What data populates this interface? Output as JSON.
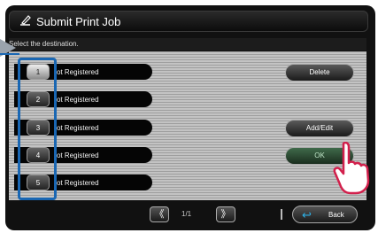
{
  "title_bar": {
    "title": "Submit Print Job",
    "icon": "edit-pen-icon"
  },
  "instruction": "Select the destination.",
  "destinations": [
    {
      "number": "1",
      "label": "ot Registered",
      "selected": true
    },
    {
      "number": "2",
      "label": "ot Registered",
      "selected": false
    },
    {
      "number": "3",
      "label": "ot Registered",
      "selected": false
    },
    {
      "number": "4",
      "label": "ot Registered",
      "selected": false
    },
    {
      "number": "5",
      "label": "ot Registered",
      "selected": false
    }
  ],
  "actions": {
    "delete": "Delete",
    "add_edit": "Add/Edit",
    "ok": "OK"
  },
  "pagination": {
    "prev": "《",
    "next": "》",
    "page": "1/1"
  },
  "back_label": "Back",
  "colors": {
    "highlight": "#1a67b3",
    "back_icon": "#2eb0e6"
  }
}
